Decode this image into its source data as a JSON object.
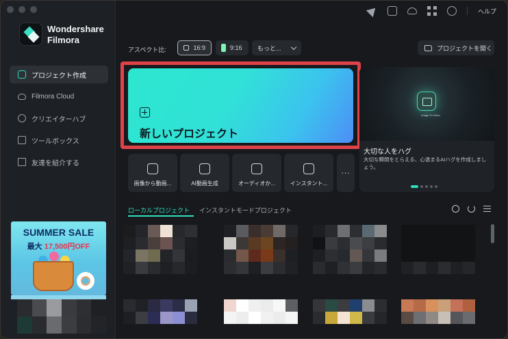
{
  "app": {
    "brand_line1": "Wondershare",
    "brand_line2": "Filmora"
  },
  "sidebar": {
    "items": [
      {
        "label": "プロジェクト作成",
        "icon": "new-project-icon",
        "active": true
      },
      {
        "label": "Filmora Cloud",
        "icon": "cloud-icon",
        "active": false
      },
      {
        "label": "クリエイターハブ",
        "icon": "lightbulb-icon",
        "active": false
      },
      {
        "label": "ツールボックス",
        "icon": "toolbox-icon",
        "active": false
      },
      {
        "label": "友達を紹介する",
        "icon": "gift-icon",
        "active": false
      }
    ],
    "promo": {
      "title": "SUMMER SALE",
      "sub_prefix": "最大",
      "sub_amount": "17,500円OFF"
    }
  },
  "topbar": {
    "icons": [
      "send-icon",
      "inbox-icon",
      "cloud-upload-icon",
      "apps-grid-icon",
      "headset-icon"
    ],
    "help_label": "ヘルプ"
  },
  "aspect": {
    "label": "アスペクト比:",
    "options": [
      "16:9",
      "9:16"
    ],
    "selected": "16:9",
    "more_label": "もっと..."
  },
  "open_project_label": "プロジェクトを開く",
  "new_project": {
    "label": "新しいプロジェクト"
  },
  "banner": {
    "image_caption": "Image To Video",
    "title": "大切な人をハグ",
    "description": "大切な瞬間をとらえる、心温まるAIハグを作成しましょう。",
    "dots_total": 5,
    "dots_active": 1
  },
  "tools": [
    {
      "label": "画像から動画...",
      "icon": "image-to-video-icon"
    },
    {
      "label": "AI動画生成",
      "icon": "ai-video-icon"
    },
    {
      "label": "オーディオか...",
      "icon": "audio-to-video-icon"
    },
    {
      "label": "インスタント...",
      "icon": "instant-mode-icon"
    }
  ],
  "tools_more": "...",
  "project_tabs": {
    "local": "ローカルプロジェクト",
    "instant": "インスタントモードプロジェクト"
  },
  "colors": {
    "accent": "#2fe0c0",
    "highlight_border": "#e0424a",
    "new_project_gradient": [
      "#2ce6cf",
      "#3bc3ee",
      "#4d8ef6"
    ]
  },
  "thumbnails": [
    {
      "cells": [
        "#1c1c1f",
        "#24252a",
        "#6a5a55",
        "#efe1d3",
        "#27282c",
        "#2e2f33",
        "#1e1f23",
        "#2a2b2f",
        "#4a3f3c",
        "#6b5350",
        "#2b2c30",
        "#1d1e21",
        "#23252a",
        "#7a7462",
        "#6f6b4f",
        "#232428",
        "#33353a",
        "#1b1c1f",
        "#202125",
        "#3a3b3f",
        "#2a2b2e",
        "#1f2024",
        "#27282b",
        "#1c1d20"
      ]
    },
    {
      "cells": [
        "#1f2023",
        "#5a5b5e",
        "#3a2e2a",
        "#4a3c35",
        "#6f6a66",
        "#26272a",
        "#c9c8c5",
        "#3b3836",
        "#5a3a22",
        "#6b4620",
        "#2d2524",
        "#24201f",
        "#2a2b2e",
        "#72574a",
        "#5e2a1e",
        "#7a3a19",
        "#3a302b",
        "#1e1f22",
        "#2c2d30",
        "#353639",
        "#1e1f22",
        "#3c3d40",
        "#2b2c2f",
        "#202124"
      ]
    },
    {
      "cells": [
        "#1d1e21",
        "#292a2d",
        "#6e6f72",
        "#2d2e31",
        "#5a6a72",
        "#8a8b8d",
        "#111214",
        "#3a3b3e",
        "#2c2d30",
        "#4a4b4e",
        "#3d3e41",
        "#2a2b2e",
        "#1e1f22",
        "#2d2e31",
        "#262a2e",
        "#645855",
        "#353639",
        "#7a7b7e",
        "#2a2b2e",
        "#1f2023",
        "#303134",
        "#3b3c3f",
        "#242528",
        "#2a2b2e"
      ]
    },
    {
      "cells": [
        "#121315",
        "#121315",
        "#121315",
        "#121315",
        "#121315",
        "#121315",
        "#121315",
        "#121315",
        "#121315",
        "#121315",
        "#121315",
        "#121315",
        "#121315",
        "#121315",
        "#121315",
        "#121315",
        "#121315",
        "#121315",
        "#202124",
        "#2a2b2e",
        "#1e1f22",
        "#2b2c2f",
        "#1f2023",
        "#252629"
      ]
    },
    {
      "cells": [
        "#2a2b2f",
        "#202126",
        "#2a2a42",
        "#3a3a60",
        "#2b2d46",
        "#9aa3b4",
        "#1e1f22",
        "#3c3d42",
        "#2c2d55",
        "#9a96c8",
        "#8d8fd4",
        "#2a2c3f"
      ]
    },
    {
      "cells": [
        "#f0d6cf",
        "#ffffff",
        "#efefef",
        "#ebebeb",
        "#f7f7f7",
        "#5e5f62",
        "#f4f4f4",
        "#ededed",
        "#ffffff",
        "#f1f1f1",
        "#ececec",
        "#f5f5f5"
      ]
    },
    {
      "cells": [
        "#35363a",
        "#2a4a44",
        "#3b3c40",
        "#1f3f6f",
        "#8a8c8f",
        "#2c2d31",
        "#2a2b2e",
        "#c9a83a",
        "#f4e3d2",
        "#d0b84a",
        "#3a3b3e",
        "#252629"
      ]
    },
    {
      "cells": [
        "#c97a55",
        "#b66a48",
        "#d8905c",
        "#caa07a",
        "#c4715a",
        "#b0603e",
        "#5a4a44",
        "#6e6f72",
        "#8f8a85",
        "#c8bfb7",
        "#55565a",
        "#6a6b6e"
      ]
    }
  ],
  "mosaic_small": {
    "cells": [
      "#2a2b2e",
      "#4a4b4e",
      "#9a9b9e",
      "#3a3b3e",
      "#2e2f32",
      "#1f2023",
      "#1e3a36",
      "#2a2b2e",
      "#6a6b6e",
      "#3c3d40",
      "#2c2d30",
      "#232427"
    ]
  }
}
